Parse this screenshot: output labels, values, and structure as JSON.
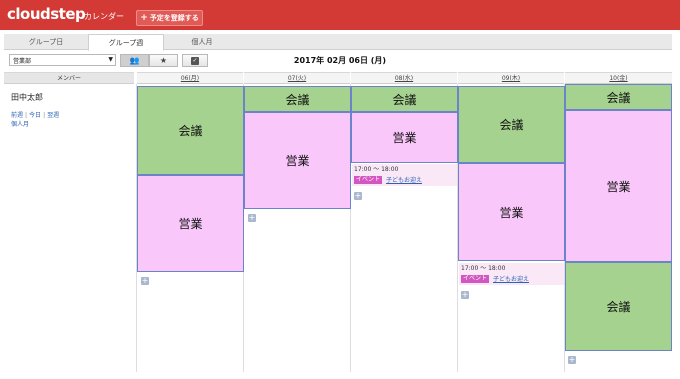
{
  "app": {
    "logo": "cloudstep",
    "logo_sub": "カレンダー",
    "add_button_label": "予定を登録する"
  },
  "tabs": [
    "グループ日",
    "グループ週",
    "個人月"
  ],
  "active_tab": "グループ週",
  "toolbar": {
    "group_selected": "営業部",
    "date_title": "2017年 02月 06日 (月)"
  },
  "header": {
    "member_col": "メンバー",
    "days": [
      "06(月)",
      "07(火)",
      "08(水)",
      "09(木)",
      "10(金)"
    ]
  },
  "member": {
    "name": "田中太郎",
    "link_prev": "前週",
    "link_today": "今日",
    "link_next": "翌週",
    "link_monthly": "個人月"
  },
  "events": {
    "d0_a": "会議",
    "d0_b": "営業",
    "d1_a": "会議",
    "d1_b": "営業",
    "d2_a": "会議",
    "d2_b": "営業",
    "d3_a": "会議",
    "d3_b": "営業",
    "d4_a": "会議",
    "d4_b": "営業",
    "d4_c": "会議"
  },
  "timed_events": {
    "time": "17:00 ～ 18:00",
    "tag": "イベント",
    "title": "子どもお迎え"
  },
  "colors": {
    "topbar": "#d33a35",
    "meeting": "#a5d28f",
    "sales": "#f9c7f9",
    "event_tag": "#d257c0"
  }
}
